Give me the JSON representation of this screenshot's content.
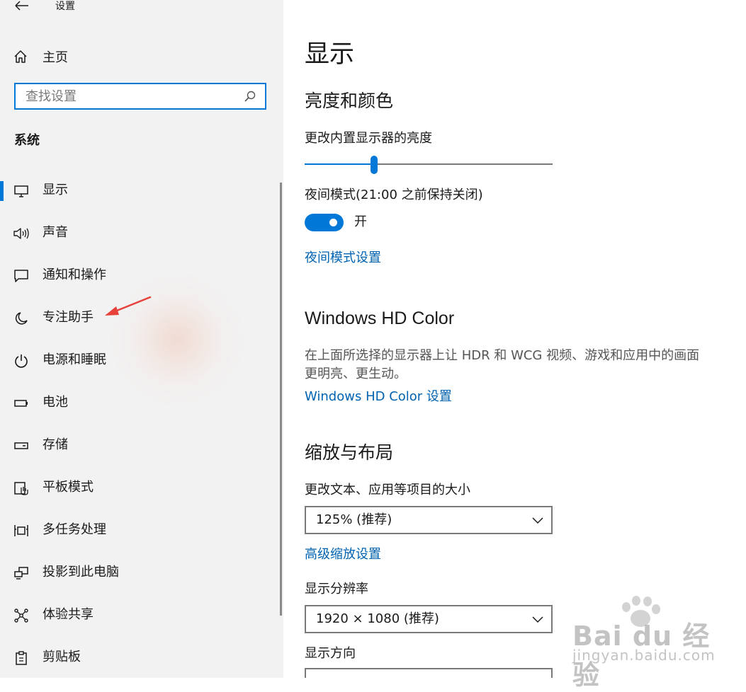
{
  "window": {
    "title": "设置"
  },
  "sidebar": {
    "home_label": "主页",
    "search": {
      "placeholder": "查找设置",
      "value": ""
    },
    "section_label": "系统",
    "items": [
      {
        "label": "显示",
        "icon": "monitor-icon",
        "active": true
      },
      {
        "label": "声音",
        "icon": "speaker-icon"
      },
      {
        "label": "通知和操作",
        "icon": "notification-icon"
      },
      {
        "label": "专注助手",
        "icon": "moon-icon"
      },
      {
        "label": "电源和睡眠",
        "icon": "power-icon"
      },
      {
        "label": "电池",
        "icon": "battery-icon"
      },
      {
        "label": "存储",
        "icon": "storage-icon"
      },
      {
        "label": "平板模式",
        "icon": "tablet-mode-icon"
      },
      {
        "label": "多任务处理",
        "icon": "multitasking-icon"
      },
      {
        "label": "投影到此电脑",
        "icon": "project-icon"
      },
      {
        "label": "体验共享",
        "icon": "share-icon"
      },
      {
        "label": "剪贴板",
        "icon": "clipboard-icon"
      }
    ]
  },
  "main": {
    "title": "显示",
    "brightness_color": {
      "heading": "亮度和颜色",
      "brightness_label": "更改内置显示器的亮度",
      "brightness_value": 0.28,
      "night_mode_label": "夜间模式(21:00 之前保持关闭)",
      "night_mode_state": "开",
      "night_mode_on": true,
      "night_mode_settings_link": "夜间模式设置"
    },
    "hd_color": {
      "heading": "Windows HD Color",
      "description": "在上面所选择的显示器上让 HDR 和 WCG 视频、游戏和应用中的画面更明亮、更生动。",
      "settings_link": "Windows HD Color 设置"
    },
    "scale_layout": {
      "heading": "缩放与布局",
      "scale_label": "更改文本、应用等项目的大小",
      "scale_value": "125% (推荐)",
      "advanced_link": "高级缩放设置",
      "resolution_label": "显示分辨率",
      "resolution_value": "1920 × 1080 (推荐)",
      "orientation_label": "显示方向"
    }
  },
  "watermark": {
    "brand": "Bai du 经验",
    "url": "jingyan.baidu.com"
  },
  "colors": {
    "accent": "#0078d7",
    "link": "#0063b1",
    "annotation_arrow": "#e8403a"
  }
}
